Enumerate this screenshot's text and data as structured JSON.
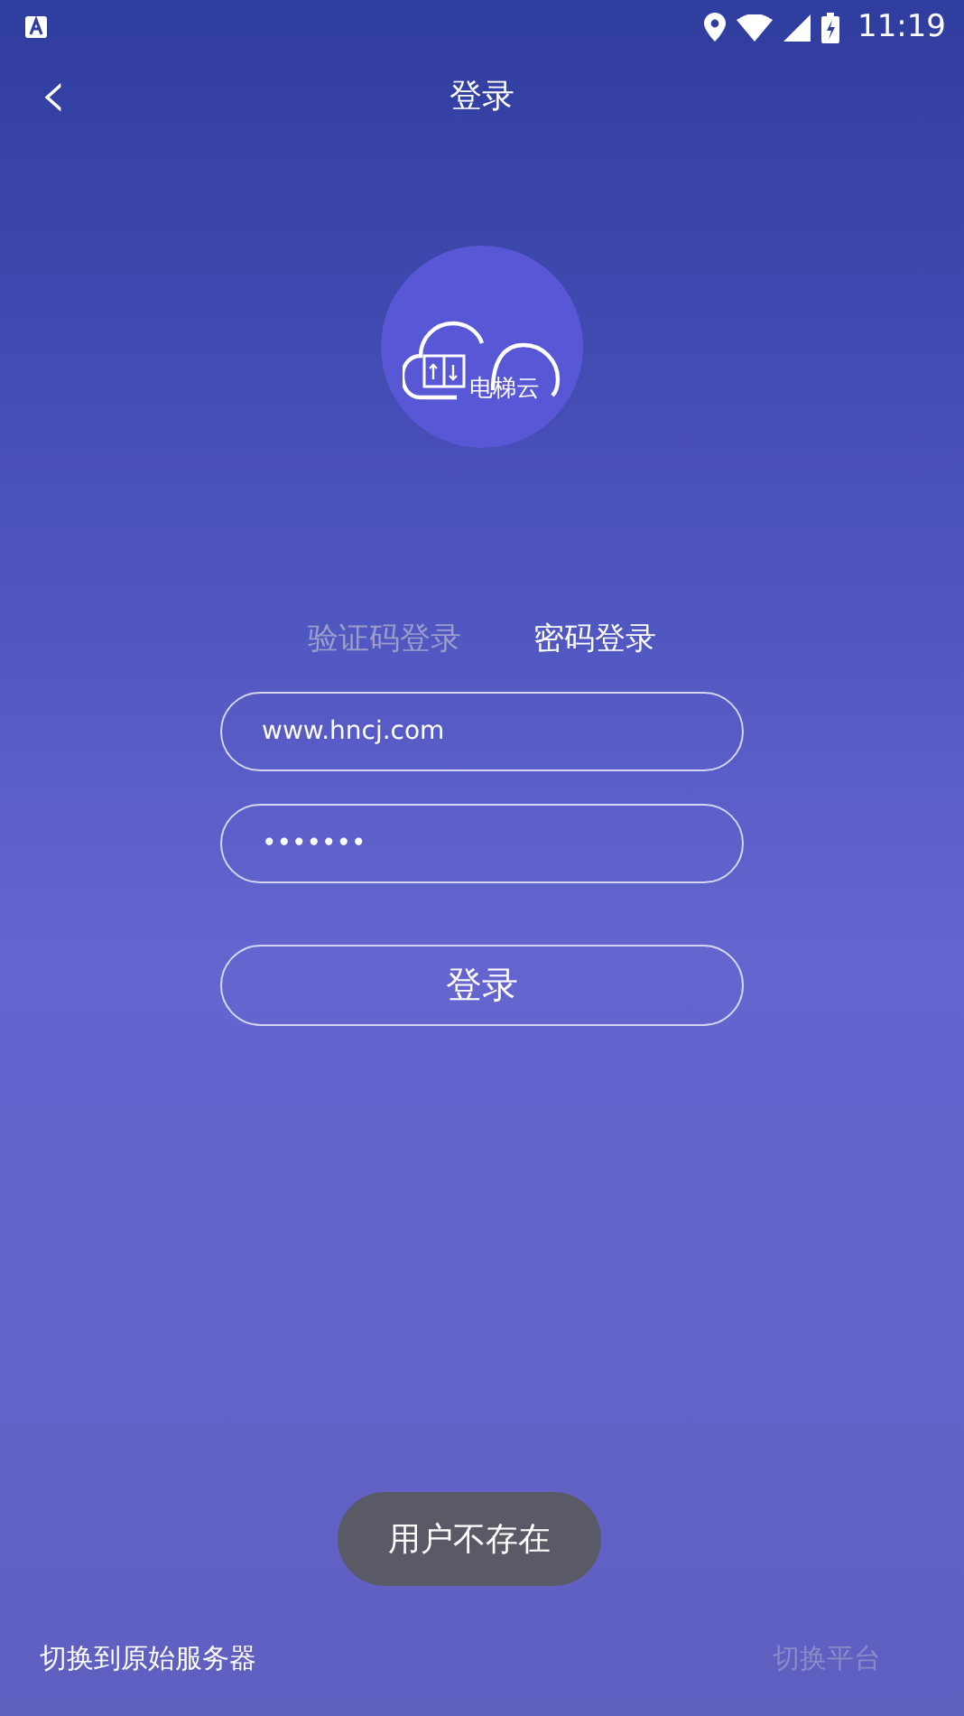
{
  "status_bar": {
    "time": "11:19"
  },
  "header": {
    "back": "‹",
    "title": "登录"
  },
  "logo": {
    "text": "电梯云"
  },
  "tabs": [
    {
      "label": "验证码登录",
      "selected": false
    },
    {
      "label": "密码登录",
      "selected": true
    }
  ],
  "fields": [
    {
      "value": "www.hncj.com"
    },
    {
      "value": "•••••••"
    }
  ],
  "login_button": "登录",
  "toast": "用户不存在",
  "footer": {
    "left": "切换到原始服务器",
    "right": "切换平台"
  }
}
